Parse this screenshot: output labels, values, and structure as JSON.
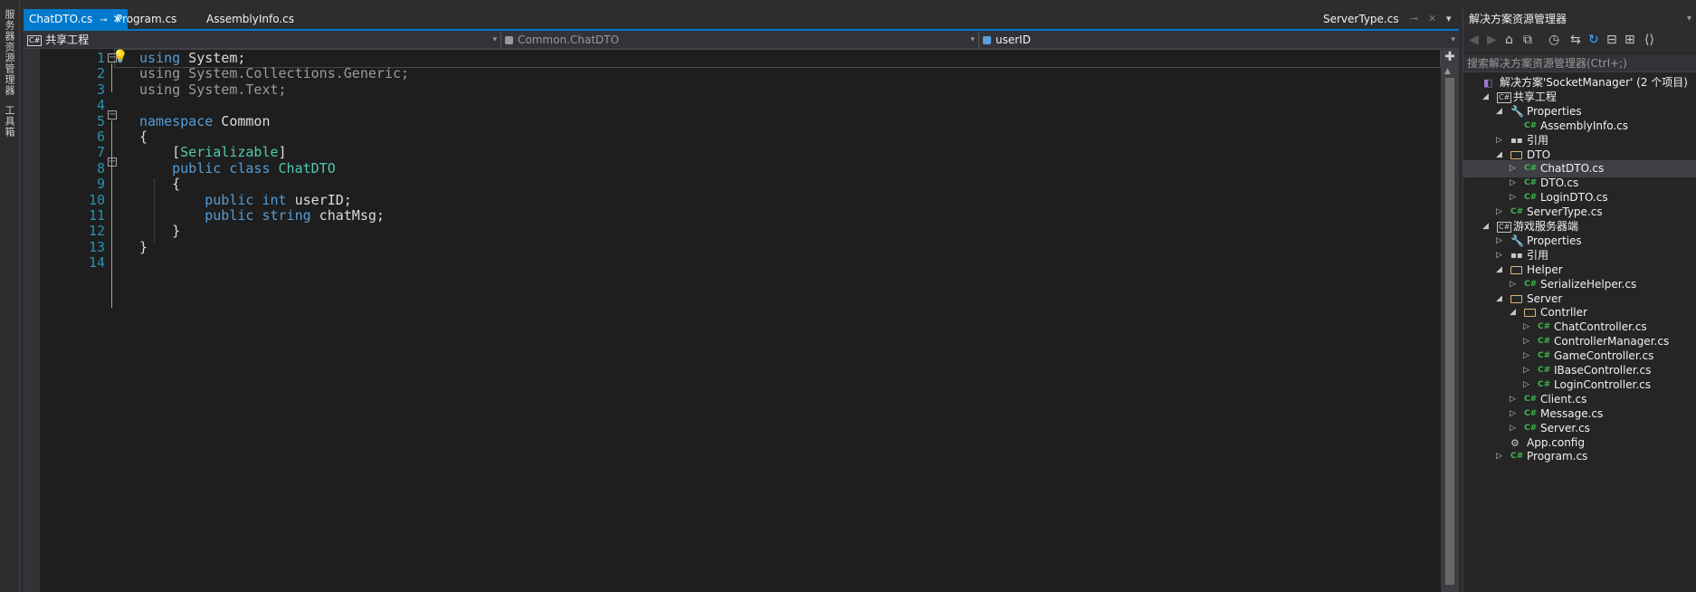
{
  "left_rail": {
    "tabs": [
      "服务器资源管理器",
      "工具箱"
    ]
  },
  "tabs": [
    {
      "label": "ChatDTO.cs",
      "active": true
    },
    {
      "label": "Program.cs",
      "active": false
    },
    {
      "label": "AssemblyInfo.cs",
      "active": false
    }
  ],
  "right_tab": {
    "label": "ServerType.cs"
  },
  "icons": {
    "pin": "⊸",
    "close": "✕",
    "dropdown": "▾"
  },
  "navbar": {
    "project": "共享工程",
    "class": "Common.ChatDTO",
    "member": "userID",
    "cs_badge": "C#"
  },
  "editor": {
    "line_numbers": [
      "1",
      "2",
      "3",
      "4",
      "5",
      "6",
      "7",
      "8",
      "9",
      "10",
      "11",
      "12",
      "13",
      "14"
    ],
    "lines": [
      {
        "n": "1",
        "tokens": [
          {
            "t": "using",
            "c": "kw"
          },
          {
            "t": " System;",
            "c": ""
          }
        ]
      },
      {
        "n": "2",
        "tokens": [
          {
            "t": "using",
            "c": "kw grey"
          },
          {
            "t": " System.Collections.Generic;",
            "c": "grey"
          }
        ]
      },
      {
        "n": "3",
        "tokens": [
          {
            "t": "using",
            "c": "kw grey"
          },
          {
            "t": " System.Text;",
            "c": "grey"
          }
        ]
      },
      {
        "n": "4",
        "tokens": []
      },
      {
        "n": "5",
        "tokens": [
          {
            "t": "namespace",
            "c": "kw"
          },
          {
            "t": " Common",
            "c": ""
          }
        ]
      },
      {
        "n": "6",
        "tokens": [
          {
            "t": "{",
            "c": ""
          }
        ]
      },
      {
        "n": "7",
        "tokens": [
          {
            "t": "    [",
            "c": ""
          },
          {
            "t": "Serializable",
            "c": "ty"
          },
          {
            "t": "]",
            "c": ""
          }
        ]
      },
      {
        "n": "8",
        "tokens": [
          {
            "t": "    ",
            "c": ""
          },
          {
            "t": "public",
            "c": "kw"
          },
          {
            "t": " ",
            "c": ""
          },
          {
            "t": "class",
            "c": "kw"
          },
          {
            "t": " ",
            "c": ""
          },
          {
            "t": "ChatDTO",
            "c": "ty"
          }
        ]
      },
      {
        "n": "9",
        "tokens": [
          {
            "t": "    {",
            "c": ""
          }
        ]
      },
      {
        "n": "10",
        "tokens": [
          {
            "t": "        ",
            "c": ""
          },
          {
            "t": "public",
            "c": "kw"
          },
          {
            "t": " ",
            "c": ""
          },
          {
            "t": "int",
            "c": "kw"
          },
          {
            "t": " userID;",
            "c": ""
          }
        ]
      },
      {
        "n": "11",
        "tokens": [
          {
            "t": "        ",
            "c": ""
          },
          {
            "t": "public",
            "c": "kw"
          },
          {
            "t": " ",
            "c": ""
          },
          {
            "t": "string",
            "c": "kw"
          },
          {
            "t": " chatMsg;",
            "c": ""
          }
        ]
      },
      {
        "n": "12",
        "tokens": [
          {
            "t": "    }",
            "c": ""
          }
        ]
      },
      {
        "n": "13",
        "tokens": [
          {
            "t": "}",
            "c": ""
          }
        ]
      },
      {
        "n": "14",
        "tokens": []
      }
    ]
  },
  "solution_explorer": {
    "title": "解决方案资源管理器",
    "search_placeholder": "搜索解决方案资源管理器(Ctrl+;)",
    "tree": [
      {
        "label": "解决方案'SocketManager' (2 个项目)",
        "icon": "sln",
        "depth": 0,
        "twisty": ""
      },
      {
        "label": "共享工程",
        "icon": "proj",
        "depth": 1,
        "twisty": "open"
      },
      {
        "label": "Properties",
        "icon": "wrench",
        "depth": 2,
        "twisty": "open"
      },
      {
        "label": "AssemblyInfo.cs",
        "icon": "cs",
        "depth": 3,
        "twisty": ""
      },
      {
        "label": "引用",
        "icon": "ref",
        "depth": 2,
        "twisty": "closed"
      },
      {
        "label": "DTO",
        "icon": "folder",
        "depth": 2,
        "twisty": "open"
      },
      {
        "label": "ChatDTO.cs",
        "icon": "cs",
        "depth": 3,
        "twisty": "closed",
        "selected": true
      },
      {
        "label": "DTO.cs",
        "icon": "cs",
        "depth": 3,
        "twisty": "closed"
      },
      {
        "label": "LoginDTO.cs",
        "icon": "cs",
        "depth": 3,
        "twisty": "closed"
      },
      {
        "label": "ServerType.cs",
        "icon": "cs",
        "depth": 2,
        "twisty": "closed"
      },
      {
        "label": "游戏服务器端",
        "icon": "proj",
        "depth": 1,
        "twisty": "open"
      },
      {
        "label": "Properties",
        "icon": "wrench",
        "depth": 2,
        "twisty": "closed"
      },
      {
        "label": "引用",
        "icon": "ref",
        "depth": 2,
        "twisty": "closed"
      },
      {
        "label": "Helper",
        "icon": "folder",
        "depth": 2,
        "twisty": "open"
      },
      {
        "label": "SerializeHelper.cs",
        "icon": "cs",
        "depth": 3,
        "twisty": "closed"
      },
      {
        "label": "Server",
        "icon": "folder",
        "depth": 2,
        "twisty": "open"
      },
      {
        "label": "Contrller",
        "icon": "folder",
        "depth": 3,
        "twisty": "open"
      },
      {
        "label": "ChatController.cs",
        "icon": "cs",
        "depth": 4,
        "twisty": "closed"
      },
      {
        "label": "ControllerManager.cs",
        "icon": "cs",
        "depth": 4,
        "twisty": "closed"
      },
      {
        "label": "GameController.cs",
        "icon": "cs",
        "depth": 4,
        "twisty": "closed"
      },
      {
        "label": "IBaseController.cs",
        "icon": "cs",
        "depth": 4,
        "twisty": "closed"
      },
      {
        "label": "LoginController.cs",
        "icon": "cs",
        "depth": 4,
        "twisty": "closed"
      },
      {
        "label": "Client.cs",
        "icon": "cs",
        "depth": 3,
        "twisty": "closed"
      },
      {
        "label": "Message.cs",
        "icon": "cs",
        "depth": 3,
        "twisty": "closed"
      },
      {
        "label": "Server.cs",
        "icon": "cs",
        "depth": 3,
        "twisty": "closed"
      },
      {
        "label": "App.config",
        "icon": "cfg",
        "depth": 2,
        "twisty": ""
      },
      {
        "label": "Program.cs",
        "icon": "cs",
        "depth": 2,
        "twisty": "closed"
      }
    ]
  }
}
